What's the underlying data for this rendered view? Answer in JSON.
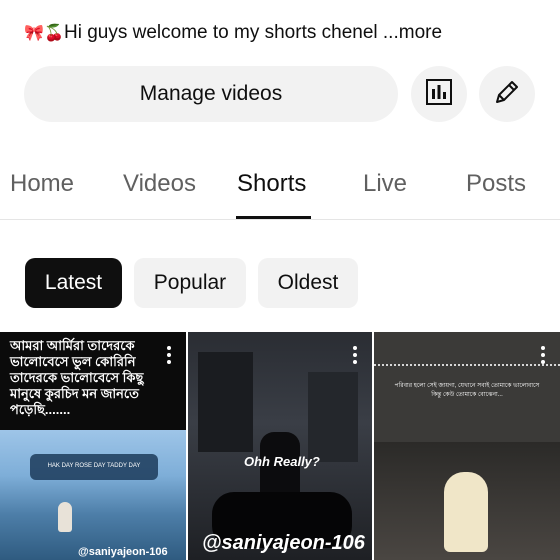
{
  "channel": {
    "description_text": "Hi guys welcome to my shorts chenel",
    "more_label": "...more",
    "emoji_1": "🎀",
    "emoji_2": "🍒"
  },
  "actions": {
    "manage_videos_label": "Manage videos",
    "analytics_icon": "bar-chart-icon",
    "edit_icon": "pencil-icon"
  },
  "tabs": [
    {
      "label": "Home"
    },
    {
      "label": "Videos"
    },
    {
      "label": "Shorts"
    },
    {
      "label": "Live"
    },
    {
      "label": "Posts"
    }
  ],
  "active_tab": "Shorts",
  "filters": [
    {
      "label": "Latest"
    },
    {
      "label": "Popular"
    },
    {
      "label": "Oldest"
    }
  ],
  "selected_filter": "Latest",
  "shorts": [
    {
      "caption": "আমরা আর্মিরা তাদেরকে ভালোবেসে ভুল কোরিনি তাদেরকে ভালোবেসে কিছু মানুষে কুরচিদ মন জানতে পড়েছি.......",
      "subcaption": "HAK DAY ROSE DAY TADDY DAY",
      "watermark": "@saniyajeon-106"
    },
    {
      "caption": "Ohh Really?",
      "watermark": "@saniyajeon-106"
    },
    {
      "caption": "পরিবার হলো সেই জায়গা, যেখানে সবাই তোমাকে ভালোবাসে কিন্তু কেউ তোমাকে বোঝেনা..."
    }
  ],
  "colors": {
    "chip_bg": "#f2f2f2",
    "chip_selected_bg": "#0f0f0f",
    "text_primary": "#0f0f0f",
    "text_secondary": "#606060"
  }
}
